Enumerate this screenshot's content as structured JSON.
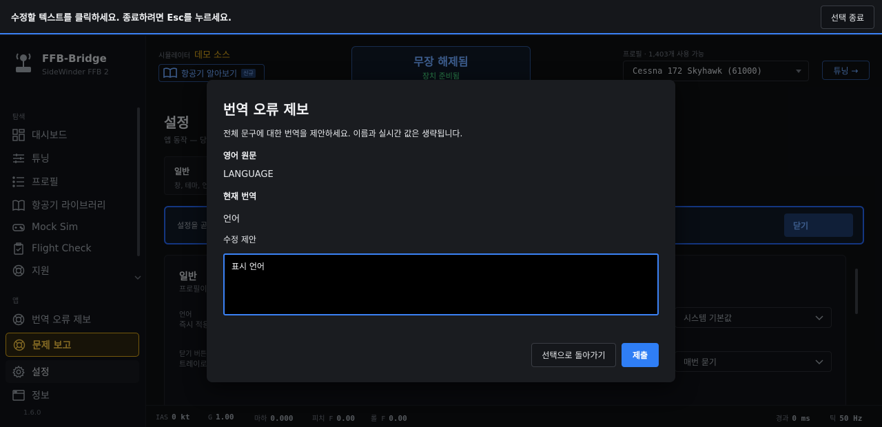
{
  "banner": {
    "message": "수정할 텍스트를 클릭하세요. 종료하려면 Esc를 누르세요.",
    "exit_label": "선택 종료"
  },
  "brand": {
    "name": "FFB-Bridge",
    "subtitle": "SideWinder FFB 2"
  },
  "sidebar": {
    "section_nav": "탐색",
    "section_app": "앱",
    "items": [
      {
        "label": "대시보드",
        "icon": "dashboard-icon"
      },
      {
        "label": "튜닝",
        "icon": "sliders-icon"
      },
      {
        "label": "프로필",
        "icon": "list-icon"
      },
      {
        "label": "항공기 라이브러리",
        "icon": "book-icon"
      },
      {
        "label": "Mock Sim",
        "icon": "gamepad-icon"
      },
      {
        "label": "Flight Check",
        "icon": "clipboard-check-icon"
      },
      {
        "label": "지원",
        "icon": "lifebuoy-icon"
      }
    ],
    "app_items": [
      {
        "label": "번역 오류 제보",
        "icon": "lifebuoy-icon"
      },
      {
        "label": "문제 보고",
        "icon": "lifebuoy-icon"
      },
      {
        "label": "설정",
        "icon": "gear-icon"
      },
      {
        "label": "정보",
        "icon": "window-icon"
      }
    ],
    "version": "1.6.0"
  },
  "header": {
    "sim_label": "시뮬레이터",
    "sim_value": "데모 소스",
    "guide_label": "항공기 알아보기",
    "guide_badge": "신규",
    "status_title": "무장 해제됨",
    "status_sub": "장치 준비됨",
    "profile_label": "프로필 · 1,403개 사용 가능",
    "profile_value": "Cessna 172 Skyhawk (61000)",
    "tune_label": "튜닝 →"
  },
  "page": {
    "title": "설정",
    "subtitle": "앱 동작 — 당",
    "category_title": "일반",
    "category_sub": "창, 테마, 언",
    "notice_text": "설정을 곧",
    "notice_close": "닫기",
    "general_title": "일반",
    "general_sub": "프로필이",
    "row1_label": "언어",
    "row1_desc": "즉시 적용",
    "row1_value": "시스템 기본값",
    "row2_label": "닫기 버튼",
    "row2_desc": "트레이로",
    "row2_value": "매번 묻기"
  },
  "statusbar": {
    "ias_label": "IAS",
    "ias_value": "0 kt",
    "g_label": "G",
    "g_value": "1.00",
    "mach_label": "마하",
    "mach_value": "0.000",
    "pitch_label": "피치 F",
    "pitch_value": "0.00",
    "roll_label": "롤 F",
    "roll_value": "0.00",
    "elapsed_label": "경과",
    "elapsed_value": "0 ms",
    "tick_label": "틱",
    "tick_value": "50 Hz"
  },
  "modal": {
    "title": "번역 오류 제보",
    "description": "전체 문구에 대한 번역을 제안하세요. 이름과 실시간 값은 생략됩니다.",
    "source_label": "영어 원문",
    "source_value": "LANGUAGE",
    "current_label": "현재 번역",
    "current_value": "언어",
    "suggest_label": "수정 제안",
    "suggest_value": "표시 언어",
    "back_label": "선택으로 돌아가기",
    "submit_label": "제출"
  },
  "colors": {
    "accent": "#3b82f6",
    "warning": "#d4a017",
    "ready": "#4ade80"
  }
}
